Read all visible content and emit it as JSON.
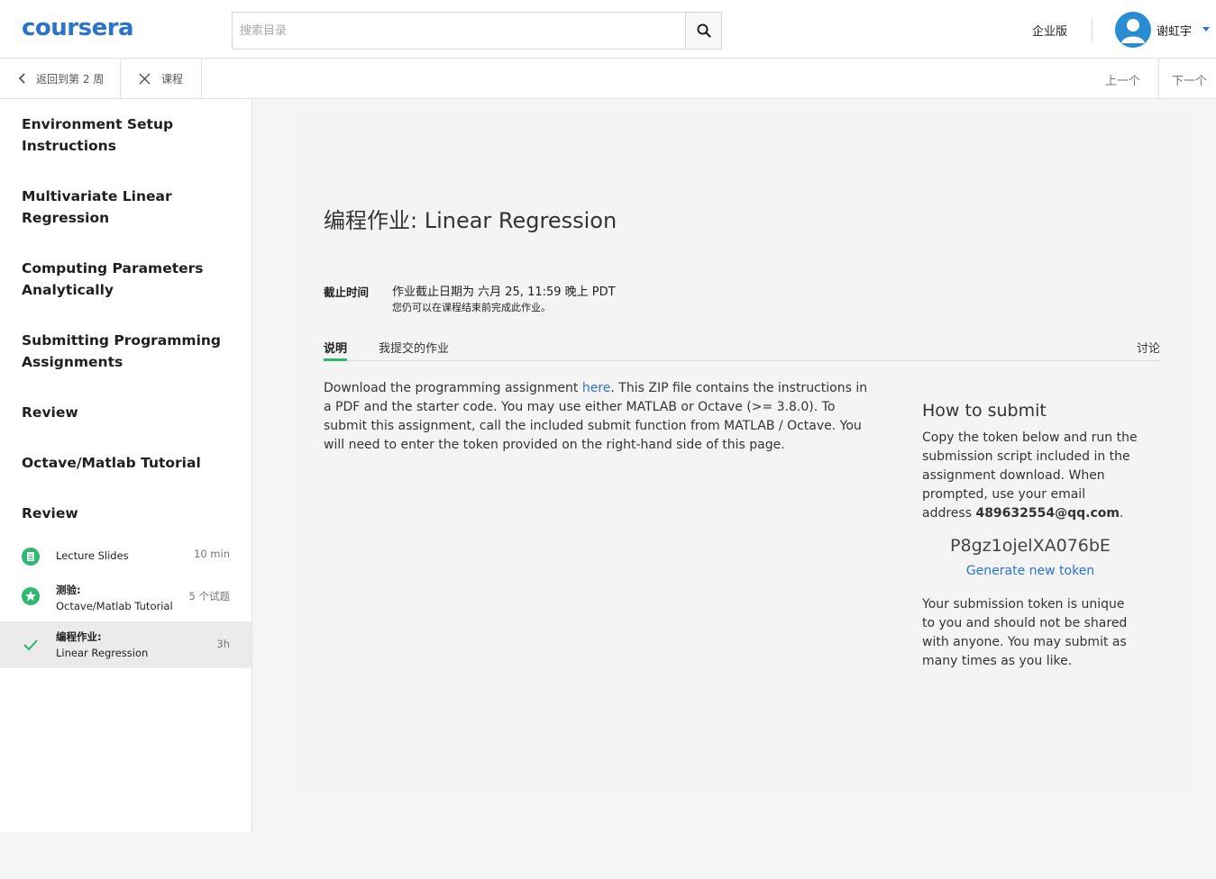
{
  "header": {
    "logo": "coursera",
    "search_placeholder": "搜索目录",
    "enterprise": "企业版",
    "username": "谢虹宇"
  },
  "subnav": {
    "back": "返回到第 2 周",
    "course": "课程",
    "prev": "上一个",
    "next": "下一个"
  },
  "sidebar": {
    "lessons": [
      "Environment Setup Instructions",
      "Multivariate Linear Regression",
      "Computing Parameters Analytically",
      "Submitting Programming Assignments",
      "Review",
      "Octave/Matlab Tutorial",
      "Review"
    ],
    "items": [
      {
        "type": "",
        "label": "Lecture Slides",
        "duration": "10 min",
        "icon": "reading-icon"
      },
      {
        "type": "测验:",
        "label": "Octave/Matlab Tutorial",
        "duration": "5 个试题",
        "icon": "quiz-icon"
      },
      {
        "type": "编程作业:",
        "label": "Linear Regression",
        "duration": "3h",
        "icon": "check-icon"
      }
    ]
  },
  "main": {
    "title": "编程作业: Linear Regression",
    "due_label": "截止时间",
    "due_text": "作业截止日期为 六月 25, 11:59 晚上 PDT",
    "due_sub": "您仍可以在课程结束前完成此作业。",
    "tabs": [
      "说明",
      "我提交的作业"
    ],
    "discuss": "讨论",
    "desc_before": "Download the programming assignment ",
    "desc_link": "here",
    "desc_after": ". This ZIP file contains the instructions in a PDF and the starter code. You may use either MATLAB or Octave (>= 3.8.0). To submit this assignment, call the included submit function from MATLAB / Octave. You will need to enter the token provided on the right-hand side of this page.",
    "submit": {
      "title": "How to submit",
      "text": "Copy the token below and run the submission script included in the assignment download. When prompted, use your email address ",
      "email": "489632554@qq.com",
      "period": ".",
      "token": "P8gz1ojelXA076bE",
      "generate": "Generate new token",
      "note": "Your submission token is unique to you and should not be shared with anyone. You may submit as many times as you like."
    }
  },
  "colors": {
    "brand": "#2a73cc",
    "accent_green": "#2eb872"
  }
}
